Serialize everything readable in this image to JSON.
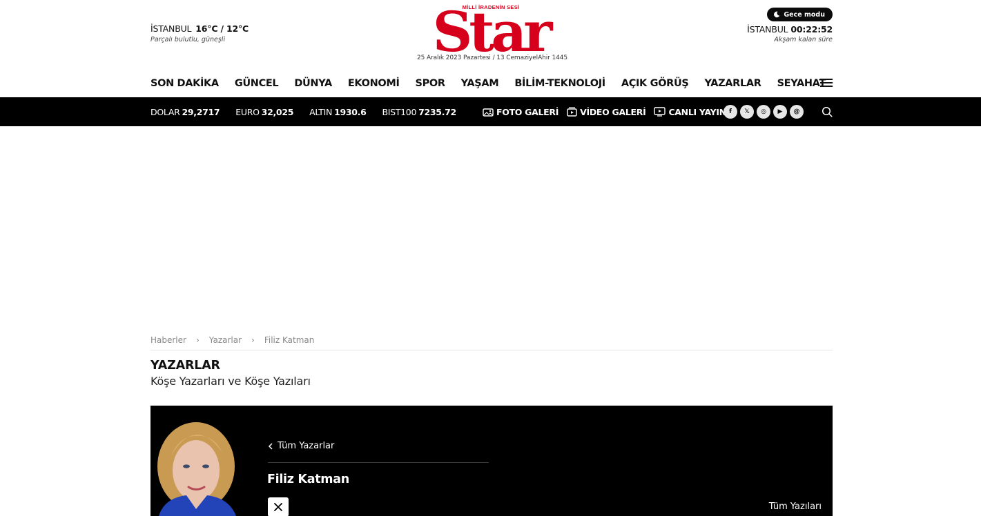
{
  "header": {
    "weather": {
      "city": "İSTANBUL",
      "temps": "16°C / 12°C",
      "desc": "Parçalı bulutlu, güneşli"
    },
    "logo": {
      "brand": "Star",
      "tagline": "MİLLİ İRADENİN SESİ",
      "color": "#d6001c"
    },
    "date_line": "25 Aralık 2023 Pazartesi / 13 CemaziyelAhir 1445",
    "night_mode_label": "Gece modu",
    "iftar": {
      "city": "İSTANBUL",
      "time": "00:22:52",
      "label": "Akşam kalan süre"
    }
  },
  "nav": {
    "items": [
      "SON DAKİKA",
      "GÜNCEL",
      "DÜNYA",
      "EKONOMİ",
      "SPOR",
      "YAŞAM",
      "BİLİM-TEKNOLOJİ",
      "AÇIK GÖRÜŞ",
      "YAZARLAR",
      "SEYAHAT"
    ],
    "menu_icon": "hamburger-icon"
  },
  "markets": [
    {
      "label": "DOLAR",
      "value": "29,2717"
    },
    {
      "label": "EURO",
      "value": "32,025"
    },
    {
      "label": "ALTIN",
      "value": "1930.6"
    },
    {
      "label": "BIST100",
      "value": "7235.72"
    }
  ],
  "media": {
    "photo_gallery": "FOTO GALERİ",
    "video_gallery": "VİDEO GALERİ",
    "live": "CANLI YAYIN"
  },
  "social": {
    "facebook": "f",
    "x": "𝕏",
    "instagram": "◎",
    "youtube": "▶",
    "threads": "@"
  },
  "breadcrumb": [
    "Haberler",
    "Yazarlar",
    "Filiz Katman"
  ],
  "section": {
    "title": "YAZARLAR",
    "subtitle": "Köşe Yazarları ve Köşe Yazıları"
  },
  "author": {
    "back_label": "Tüm Yazarlar",
    "name": "Filiz Katman",
    "all_posts_label": "Tüm Yazıları"
  }
}
